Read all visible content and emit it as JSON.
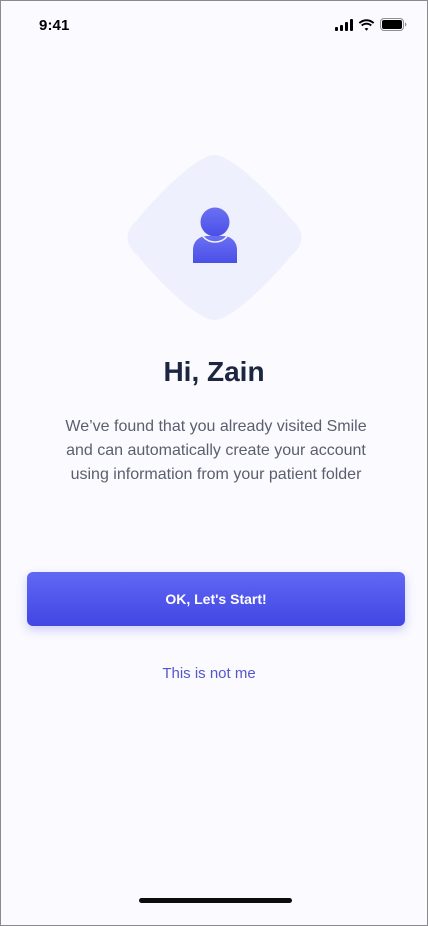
{
  "status_bar": {
    "time": "9:41",
    "icons": [
      "cellular-signal-icon",
      "wifi-icon",
      "battery-icon"
    ]
  },
  "avatar": {
    "icon": "user-icon",
    "background_color": "#eef0fd",
    "icon_color": "#5a60f0"
  },
  "greeting": {
    "title": "Hi, Zain",
    "description": "We’ve found that you already visited Smile and can automatically create your account using information from your patient folder"
  },
  "actions": {
    "primary_label": "OK, Let's Start!",
    "secondary_label": "This is not me"
  },
  "colors": {
    "accent": "#4d52ea",
    "title_text": "#1c2640",
    "body_text": "#5b5f6d",
    "link_text": "#5457cc"
  }
}
